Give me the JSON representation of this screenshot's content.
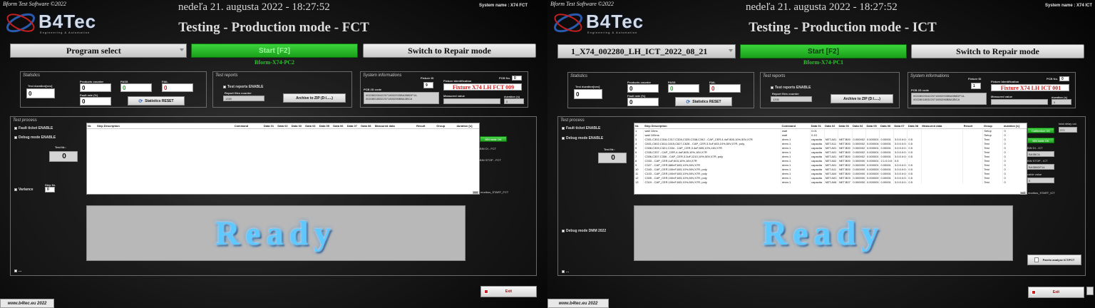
{
  "left": {
    "app_title": "Bform Test Software ©2022",
    "logo": "B4Tec",
    "logo_sub": "Engineering & Automation",
    "datetime": "nedeľa 21. augusta 2022 - 18:27:52",
    "system_name": "System name : X74 FCT",
    "title": "Testing - Production mode - FCT",
    "program_select": "Program select",
    "start_button": "Start [F2]",
    "repair_button": "Switch to Repair mode",
    "pc_name": "Bform-X74-PC2",
    "statistics": {
      "label": "Statistics",
      "test_duration_label": "Test duration[sec]",
      "test_duration": "0",
      "products_counter_label": "Products counter",
      "products_counter": "0",
      "pass_label": "PASS",
      "pass": "0",
      "fail_label": "FAIL",
      "fail": "0",
      "fault_rate_label": "Fault rate (%)",
      "fault_rate": "0",
      "reset_button": "Statistics RESET"
    },
    "test_reports": {
      "label": "Test reports",
      "enable_label": "Test reports ENABLE",
      "files_counter_label": "Report files counter",
      "files_counter": "1330",
      "archive_button": "Archive to ZIP  (D:\\.....)"
    },
    "system_info": {
      "label": "System informations",
      "fixture_id_label": "Fixture ID",
      "fixture_id": "9",
      "pcb_no_label": "PCB No.",
      "pcb_no": "0",
      "pcb_2d_label": "PCB 2D code",
      "pcb_2d_code": "0022802004220718002935BA3B8DP14- 002280180322071800296BBA3BCA",
      "fixture_ident_label": "Fixture identification",
      "fixture_ident": "Fixture X74 LH FCT 009",
      "measured_label": "Measured value",
      "duration_label": "duration (s)",
      "duration": "0"
    },
    "test_process": {
      "label": "Test process",
      "fault_ticket": "Fault ticket ENABLE",
      "debug_mode": "Debug mode ENABLE",
      "test_nr_label": "Test Nr.:",
      "test_nr": "0",
      "variance_label": "Variance",
      "step_nr_label": "Step Nr.",
      "step_nr": "0",
      "dots_label": "..."
    },
    "table_headers": [
      "Nr.",
      "Step Description",
      "Command",
      "Data 01",
      "Data 02",
      "Data 03",
      "Data 04",
      "Data 05",
      "Data 06",
      "Data 07",
      "Data 08",
      "Measured data",
      "Result",
      "Group",
      "duration [s]"
    ],
    "side": {
      "bin_table_ok": "BIN table OK",
      "bin_di_label": "BIN DI - FCT",
      "bin_stop_label": "BIN STOP - FCT",
      "modbus_label": "modbus_START_FCT"
    },
    "ready": "Ready",
    "web": "www.b4tec.eu 2022",
    "exit": "Exit"
  },
  "right": {
    "app_title": "Bform Test Software ©2022",
    "logo": "B4Tec",
    "logo_sub": "Engineering & Automation",
    "datetime": "nedeľa 21. augusta 2022 - 18:27:52",
    "system_name": "System name : X74 ICT",
    "title": "Testing - Production mode - ICT",
    "program_select": "1_X74_002280_LH_ICT_2022_08_21",
    "start_button": "Start [F2]",
    "repair_button": "Switch to Repair mode",
    "pc_name": "Bform-X74-PC1",
    "statistics": {
      "label": "Statistics",
      "test_duration_label": "Test duration[sec]",
      "test_duration": "0",
      "products_counter_label": "Products counter",
      "products_counter": "0",
      "pass_label": "PASS",
      "pass": "0",
      "fail_label": "FAIL",
      "fail": "0",
      "fault_rate_label": "Fault rate (%)",
      "fault_rate": "0",
      "reset_button": "Statistics RESET"
    },
    "test_reports": {
      "label": "Test reports",
      "enable_label": "Test reports ENABLE",
      "files_counter_label": "Report files counter",
      "files_counter": "1330",
      "archive_button": "Archive to ZIP  (D:\\.....)"
    },
    "system_info": {
      "label": "System informations",
      "fixture_id_label": "Fixture ID",
      "fixture_id": "1",
      "pcb_no_label": "PCB No.",
      "pcb_no": "0",
      "pcb_2d_label": "PCB 2D code",
      "pcb_2d_code": "0022802004220718002935BA3B8DP14- 002280180322071800296BBA3BCA",
      "fixture_ident_label": "Fixture identification",
      "fixture_ident": "Fixture X74 LH ICT 001",
      "measured_label": "Measured value",
      "duration_label": "duration (s)",
      "duration": "0"
    },
    "test_process": {
      "label": "Test process",
      "fault_ticket": "Fault ticket ENABLE",
      "debug_mode": "Debug mode ENABLE",
      "test_nr_label": "Test Nr.:",
      "test_nr": "0",
      "debug_dmm": "Debug mode DMM 2022",
      "dots_label": "..."
    },
    "table_headers": [
      "Nr.",
      "Step Description",
      "Command",
      "Data 01",
      "Data 02",
      "Data 03",
      "Data 04",
      "Data 05",
      "Data 06",
      "Data 07",
      "Data 08",
      "Measured data",
      "Result",
      "Group",
      "duration [s]"
    ],
    "table_rows": [
      [
        "1",
        "wait 10ms",
        "wait",
        "0.01",
        "",
        "",
        "",
        "",
        "",
        "",
        "",
        "",
        "",
        "Setup",
        "0"
      ],
      [
        "2",
        "wait 100ms",
        "wait",
        "0.10",
        "",
        "",
        "",
        "",
        "",
        "",
        "",
        "",
        "",
        "Setup",
        "0"
      ],
      [
        "3",
        "C301,C302,C316,C317,C328,C329,C338,C342 - CAP_CER,4.4uF,805,10%,50V,X7R",
        "dmm.1",
        "capacita",
        "NET.A01",
        "NET.B00",
        "0.000002",
        "0.000001",
        "0.00001",
        "3.0:0.0:0:",
        "0.5",
        "",
        "",
        "Test",
        "0"
      ],
      [
        "4",
        "C601,C602,C614,C615,C627,C628 - CAP_CER,3.3uF,603,10%,50V,X7R, poly,",
        "dmm.1",
        "capacita",
        "NET.A11",
        "NET.B00",
        "0.000002",
        "0.000004",
        "0.00001",
        "3.0:0.0:0:",
        "0.5",
        "",
        "",
        "Test",
        "0"
      ],
      [
        "5",
        "C308,C309,C321,C334 - CAP_CER,3.4uF,805,10%,16V,X7R",
        "dmm.1",
        "capacita",
        "NET.A01",
        "NET.B00",
        "0.000002",
        "0.000001",
        "0.00001",
        "3.0:0.0:0:",
        "0.5",
        "",
        "",
        "Test",
        "0"
      ],
      [
        "6",
        "C335,C337 - CAP_CER,4.4uF,805,10%,16V,X7R",
        "dmm.1",
        "capacita",
        "NET.A01",
        "NET.B00",
        "0.000002",
        "0.000001",
        "0.00001",
        "3.0:0.0:0:",
        "0.5",
        "",
        "",
        "Test",
        "0"
      ],
      [
        "7",
        "C306,C307,C336 - CAP_CER,3.3uF,1210,10%,50V,X7R, poly",
        "dmm.1",
        "capacita",
        "NET.A01",
        "NET.B00",
        "0.000002",
        "0.000001",
        "0.00001",
        "3.0:0.0:0:",
        "0.5",
        "",
        "",
        "Test",
        "0"
      ],
      [
        "8",
        "C333 - CAP_CER,1uF,603,10%,16V,X7R",
        "dmm.1",
        "capacita",
        "NET.A02",
        "NET.B00",
        "0.000000",
        "0.000001",
        "2.1:0.0:0:",
        "0.5",
        "",
        "",
        "",
        "Test",
        "0"
      ],
      [
        "9",
        "C327 - CAP_CER,680nF,603,10%,50V,X7R",
        "dmm.1",
        "capacita",
        "NET.A01",
        "NET.B02",
        "0.000000",
        "0.000001",
        "0.00001",
        "3.0:0.0:0:",
        "0.5",
        "",
        "",
        "Test",
        "0"
      ],
      [
        "10",
        "C343 - CAP_CER,100nF,603,10%,50V,X7R, poly",
        "dmm.1",
        "capacita",
        "NET.A11",
        "NET.B00",
        "0.000000",
        "0.000000",
        "0.00001",
        "3.0:0.0:0:",
        "0.5",
        "",
        "",
        "Test",
        "0"
      ],
      [
        "11",
        "C103 - CAP_CER,100nF,603,10%,50V,X7R, poly",
        "dmm.1",
        "capacita",
        "NET.A04",
        "NET.B00",
        "0.000000",
        "0.000000",
        "0.00001",
        "3.0:0.0:0:",
        "0.5",
        "",
        "",
        "Test",
        "0"
      ],
      [
        "12",
        "C305 - CAP_CER,100nF,603,10%,50V,X7R, poly",
        "dmm.1",
        "capacita",
        "NET.A0C",
        "NET.B03",
        "0.000000",
        "0.000000",
        "0.00001",
        "3.0:0.0:0:",
        "0.5",
        "",
        "",
        "Test",
        "0"
      ],
      [
        "13",
        "C319 - CAP_CER,100nF,603,10%,50V,X7R, poly",
        "dmm.1",
        "capacita",
        "NET.A06",
        "NET.B07",
        "0.000000",
        "0.000000",
        "0.00001",
        "3.0:0.0:0:",
        "0.5",
        "",
        "",
        "Test",
        "0"
      ]
    ],
    "side": {
      "total_delay_label": "total delay cal.",
      "total_delay": "371",
      "calibration_ok": "Calibration OK",
      "bin_table_ok": "BIN table OK",
      "bin_di_label": "BIN DI - ICT",
      "bin_di": "BA3BCA",
      "bin_stop_label": "BIN STOP - ICT",
      "bin_stop": "BA3B8DP14",
      "cable_label": "cable value",
      "cable_value": "0",
      "modbus_label": "modbus_START_ICT",
      "pareto_button": "Pareto analyse ICT/FCT"
    },
    "ready": "Ready",
    "web": "www.b4tec.eu 2022",
    "exit": "Exit"
  }
}
